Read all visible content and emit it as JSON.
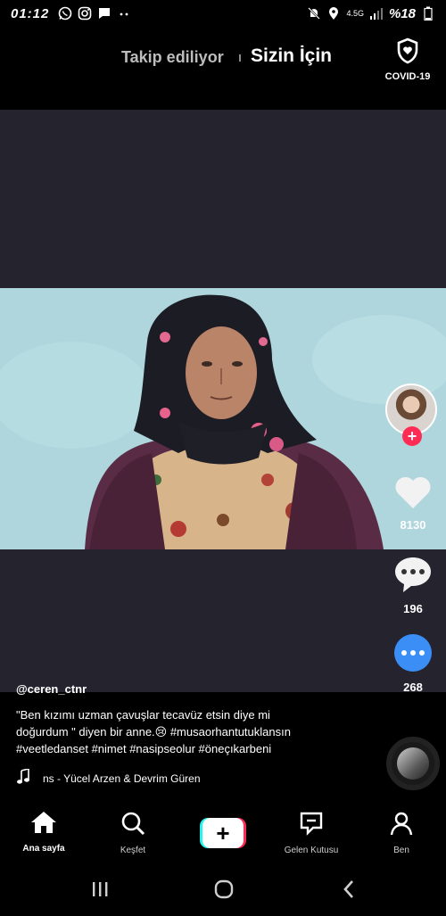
{
  "status_bar": {
    "time": "01:12",
    "network_label": "4.5G",
    "battery_text": "%18",
    "left_icons": [
      "whatsapp-icon",
      "instagram-icon",
      "message-icon",
      "more-dots-icon"
    ],
    "right_icons": [
      "mute-icon",
      "location-icon",
      "signal-icon",
      "battery-icon"
    ]
  },
  "top_nav": {
    "following_label": "Takip ediliyor",
    "for_you_label": "Sizin İçin",
    "covid_label": "COVID-19"
  },
  "side_actions": {
    "like_count": "8130",
    "comment_count": "196",
    "share_count": "268"
  },
  "post": {
    "username": "@ceren_ctnr",
    "description_line1": "\"Ben kızımı uzman çavuşlar tecavüz etsin diye mi",
    "description_line2": "doğurdum \" diyen bir anne.😢 #musaorhantutuklansın",
    "description_line3": "#veetledanset #nimet #nasipseolur  #öneçıkarbeni",
    "music_text": "ns - Yücel Arzen & Devrim Güren"
  },
  "bottom_nav": {
    "home_label": "Ana sayfa",
    "discover_label": "Keşfet",
    "create_label": "+",
    "inbox_label": "Gelen Kutusu",
    "profile_label": "Ben"
  },
  "colors": {
    "accent": "#fe2c55",
    "accent2": "#25f4ee",
    "share_blue": "#3a8ef6",
    "background": "#000000",
    "video_bg": "#25232e"
  }
}
